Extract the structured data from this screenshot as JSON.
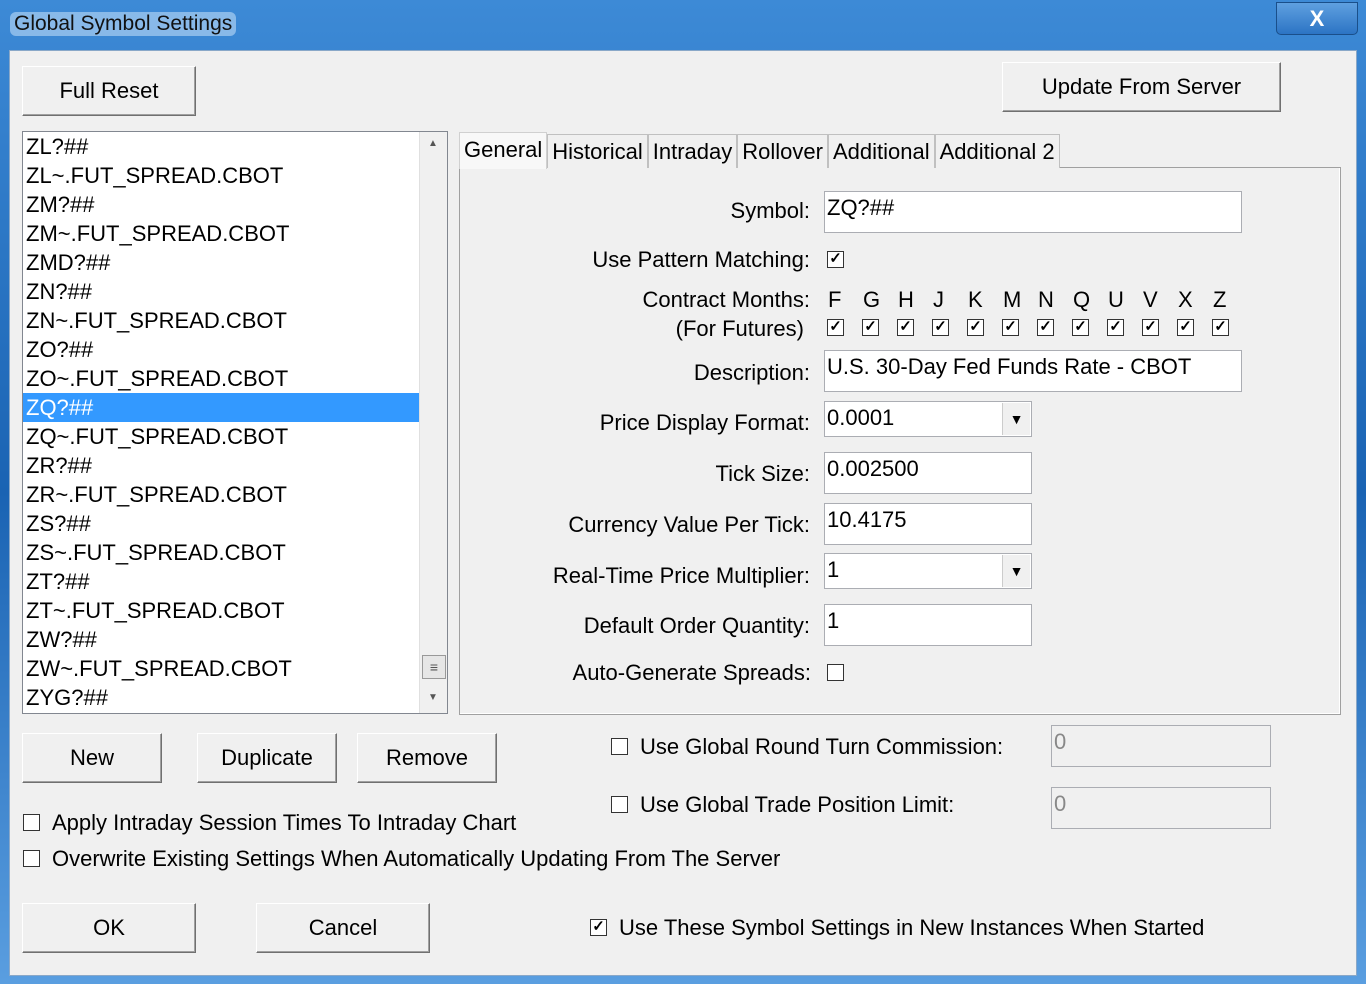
{
  "window": {
    "title": "Global Symbol Settings",
    "close": "X"
  },
  "buttons": {
    "full_reset": "Full Reset",
    "update_from_server": "Update From Server",
    "new": "New",
    "duplicate": "Duplicate",
    "remove": "Remove",
    "ok": "OK",
    "cancel": "Cancel"
  },
  "symbols": [
    "ZL?##",
    "ZL~.FUT_SPREAD.CBOT",
    "ZM?##",
    "ZM~.FUT_SPREAD.CBOT",
    "ZMD?##",
    "ZN?##",
    "ZN~.FUT_SPREAD.CBOT",
    "ZO?##",
    "ZO~.FUT_SPREAD.CBOT",
    "ZQ?##",
    "ZQ~.FUT_SPREAD.CBOT",
    "ZR?##",
    "ZR~.FUT_SPREAD.CBOT",
    "ZS?##",
    "ZS~.FUT_SPREAD.CBOT",
    "ZT?##",
    "ZT~.FUT_SPREAD.CBOT",
    "ZW?##",
    "ZW~.FUT_SPREAD.CBOT",
    "ZYG?##"
  ],
  "selected_symbol": "ZQ?##",
  "tabs": [
    "General",
    "Historical",
    "Intraday",
    "Rollover",
    "Additional",
    "Additional 2"
  ],
  "form": {
    "symbol_label": "Symbol:",
    "symbol": "ZQ?##",
    "pattern_label": "Use Pattern Matching:",
    "pattern": true,
    "months_label": "Contract Months:",
    "months_label2": "(For Futures)",
    "months": [
      "F",
      "G",
      "H",
      "J",
      "K",
      "M",
      "N",
      "Q",
      "U",
      "V",
      "X",
      "Z"
    ],
    "desc_label": "Description:",
    "desc": "U.S. 30-Day Fed Funds Rate - CBOT",
    "price_fmt_label": "Price Display Format:",
    "price_fmt": "0.0001",
    "tick_label": "Tick Size:",
    "tick": "0.002500",
    "cvpt_label": "Currency Value Per Tick:",
    "cvpt": "10.4175",
    "rtpm_label": "Real-Time Price Multiplier:",
    "rtpm": "1",
    "doq_label": "Default Order Quantity:",
    "doq": "1",
    "ags_label": "Auto-Generate Spreads:",
    "ags": false
  },
  "options": {
    "rtc_label": "Use Global Round Turn Commission:",
    "rtc": "0",
    "tpl_label": "Use Global Trade Position Limit:",
    "tpl": "0",
    "session_label": "Apply Intraday Session Times To Intraday Chart",
    "overwrite_label": "Overwrite Existing Settings When Automatically Updating From The Server",
    "new_instances_label": "Use These Symbol Settings in New Instances When Started"
  },
  "check": "✓"
}
